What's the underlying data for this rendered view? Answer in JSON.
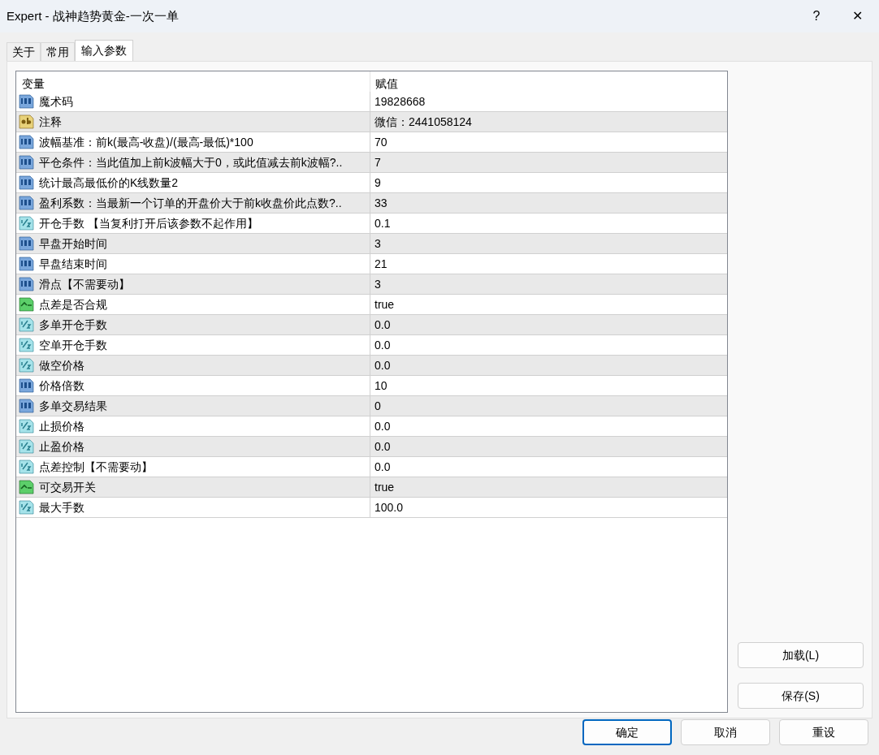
{
  "window": {
    "title": "Expert - 战神趋势黄金-一次一单",
    "help": "?",
    "close": "✕"
  },
  "tabs": [
    {
      "label": "关于",
      "selected": false
    },
    {
      "label": "常用",
      "selected": false
    },
    {
      "label": "输入参数",
      "selected": true
    }
  ],
  "table": {
    "columns": [
      "变量",
      "赋值"
    ],
    "rows": [
      {
        "kind": "int",
        "name": "魔术码",
        "value": "19828668"
      },
      {
        "kind": "string",
        "name": "注释",
        "value": "微信：2441058124"
      },
      {
        "kind": "int",
        "name": "波幅基准：前k(最高-收盘)/(最高-最低)*100",
        "value": "70"
      },
      {
        "kind": "int",
        "name": "平仓条件：当此值加上前k波幅大于0，或此值减去前k波幅?..",
        "value": "7"
      },
      {
        "kind": "int",
        "name": "统计最高最低价的K线数量2",
        "value": "9"
      },
      {
        "kind": "int",
        "name": "盈利系数：当最新一个订单的开盘价大于前k收盘价此点数?..",
        "value": "33"
      },
      {
        "kind": "double",
        "name": "开仓手数 【当复利打开后该参数不起作用】",
        "value": "0.1"
      },
      {
        "kind": "int",
        "name": "早盘开始时间",
        "value": "3"
      },
      {
        "kind": "int",
        "name": "早盘结束时间",
        "value": "21"
      },
      {
        "kind": "int",
        "name": "滑点【不需要动】",
        "value": "3"
      },
      {
        "kind": "bool",
        "name": "点差是否合规",
        "value": "true"
      },
      {
        "kind": "double",
        "name": "多单开仓手数",
        "value": "0.0"
      },
      {
        "kind": "double",
        "name": "空单开仓手数",
        "value": "0.0"
      },
      {
        "kind": "double",
        "name": "做空价格",
        "value": "0.0"
      },
      {
        "kind": "int",
        "name": "价格倍数",
        "value": "10"
      },
      {
        "kind": "int",
        "name": "多单交易结果",
        "value": "0"
      },
      {
        "kind": "double",
        "name": "止损价格",
        "value": "0.0"
      },
      {
        "kind": "double",
        "name": "止盈价格",
        "value": "0.0"
      },
      {
        "kind": "double",
        "name": "点差控制【不需要动】",
        "value": "0.0"
      },
      {
        "kind": "bool",
        "name": "可交易开关",
        "value": "true"
      },
      {
        "kind": "double",
        "name": "最大手数",
        "value": "100.0"
      }
    ]
  },
  "side_buttons": [
    "加载(L)",
    "保存(S)"
  ],
  "buttons": [
    {
      "label": "确定",
      "default": true
    },
    {
      "label": "取消",
      "default": false
    },
    {
      "label": "重设",
      "default": false
    }
  ]
}
